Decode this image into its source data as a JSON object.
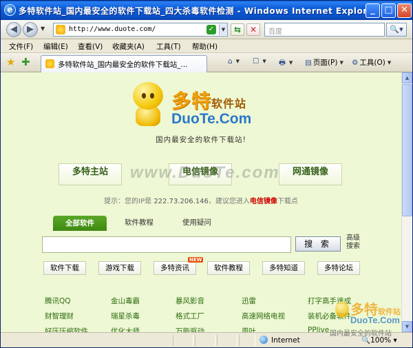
{
  "window": {
    "title": "多特软件站_国内最安全的软件下载站_四大杀毒软件检测 - Windows Internet Explorer",
    "ie_icon": "e",
    "minimize": "_",
    "maximize": "□",
    "close": "✕"
  },
  "address_bar": {
    "back": "◀",
    "forward": "▶",
    "url": "http://www.duote.com/",
    "search_placeholder": "百度",
    "search_go": "🔍▾"
  },
  "menu": [
    "文件(F)",
    "编辑(E)",
    "查看(V)",
    "收藏夹(A)",
    "工具(T)",
    "帮助(H)"
  ],
  "tab": {
    "label": "多特软件站_国内最安全的软件下载站_..."
  },
  "commands": {
    "home": "⌂",
    "feeds": "☐",
    "print": "🖶",
    "page": "页面(P)",
    "tools": "工具(O)"
  },
  "page": {
    "logo_cn": "多特",
    "logo_cn_small": "软件站",
    "logo_en": "DuoTe.Com",
    "slogan": "国内最安全的软件下载站!",
    "mirrors": [
      "多特主站",
      "电信镜像",
      "网通镜像"
    ],
    "watermark": "www.DuoTe.com",
    "tip_prefix": "提示：您的IP是",
    "tip_ip": "222.73.206.146",
    "tip_mid": "，建议您进入",
    "tip_link": "电信镜像",
    "tip_suffix": "下载点",
    "search_tabs": [
      "全部软件",
      "软件教程",
      "使用疑问"
    ],
    "search_button": "搜 索",
    "advanced_search": "高级搜索",
    "quick_links": [
      "软件下载",
      "游戏下载",
      "多特资讯",
      "软件教程",
      "多特知道",
      "多特论坛"
    ],
    "new_badge": "NEW",
    "software_rows": [
      [
        "腾讯QQ",
        "金山毒霸",
        "暴风影音",
        "迅雷",
        "打字高手速成"
      ],
      [
        "财智理财",
        "瑞星杀毒",
        "格式工厂",
        "高速网络电视",
        "装机必备软件"
      ],
      [
        "好压压缩软件",
        "优化大师",
        "万能驱动",
        "周叶",
        "PPlive"
      ]
    ],
    "corner_watermark_cn": "多特",
    "corner_watermark_cn_small": "软件站",
    "corner_watermark_en": "DuoTe.Com",
    "corner_watermark_sub": "国内最安全的软件站"
  },
  "status": {
    "zone": "Internet",
    "zoom": "100%"
  },
  "colors": {
    "content_bg": "#eef8d4",
    "tab_active": "#4e9a1e",
    "link_green": "#2c6b10",
    "logo_orange": "#f2a10a",
    "logo_blue": "#2a78c8",
    "tip_red": "#d10000"
  }
}
